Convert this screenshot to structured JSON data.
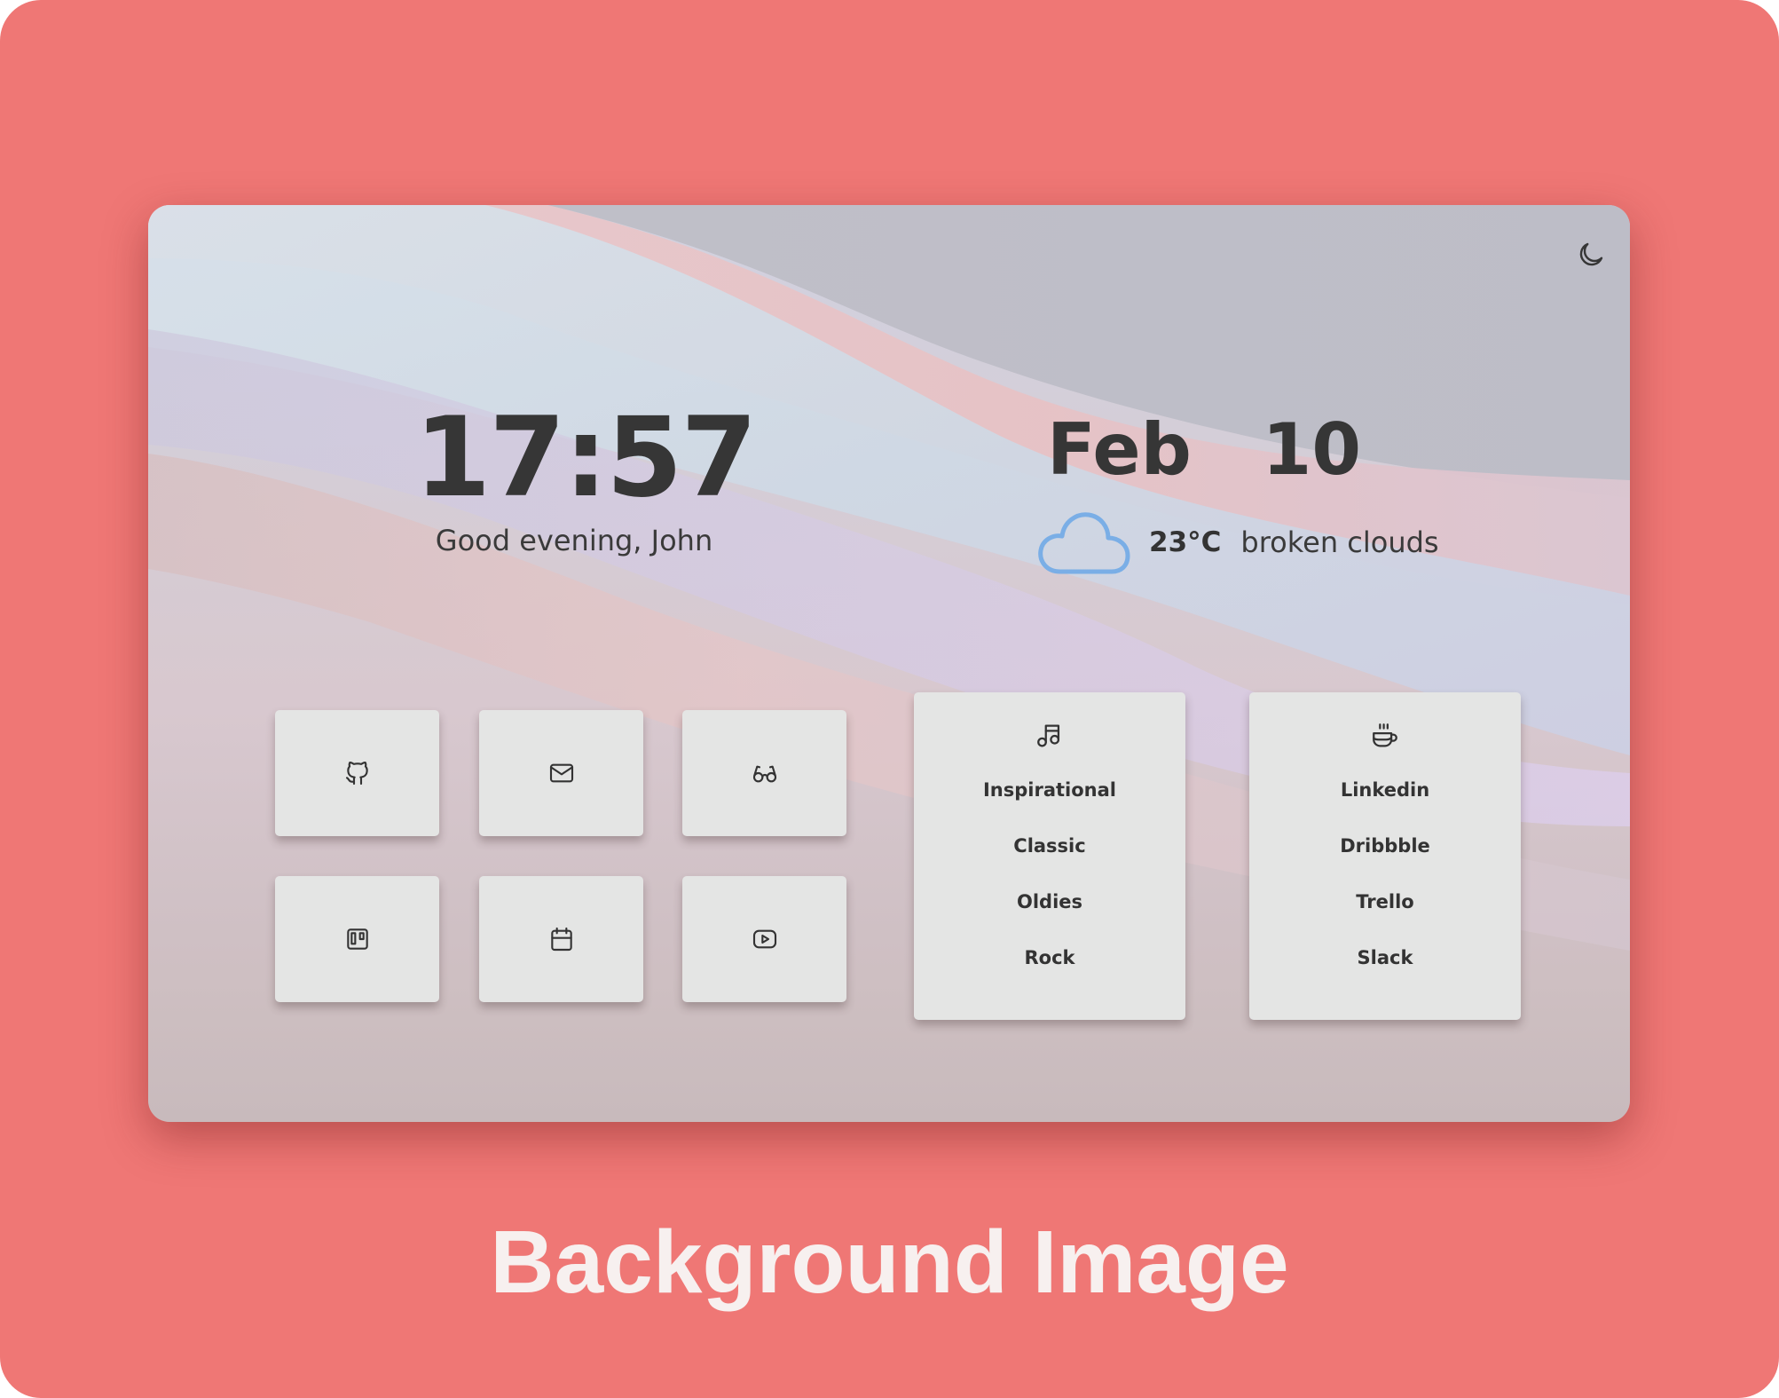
{
  "clock": {
    "time": "17:57",
    "greeting": "Good evening, John"
  },
  "date": {
    "text": "Feb  10"
  },
  "weather": {
    "temperature": "23°C",
    "condition": "broken clouds",
    "icon": "cloud-icon",
    "icon_color": "#7aaee6"
  },
  "theme_toggle": {
    "icon": "moon-icon"
  },
  "shortcuts": [
    {
      "icon": "github-icon"
    },
    {
      "icon": "mail-icon"
    },
    {
      "icon": "glasses-icon"
    },
    {
      "icon": "trello-icon"
    },
    {
      "icon": "calendar-icon"
    },
    {
      "icon": "youtube-icon"
    }
  ],
  "music_card": {
    "icon": "music-note-icon",
    "items": [
      "Inspirational",
      "Classic",
      "Oldies",
      "Rock"
    ]
  },
  "work_card": {
    "icon": "coffee-cup-icon",
    "items": [
      "Linkedin",
      "Dribbble",
      "Trello",
      "Slack"
    ]
  },
  "caption": "Background Image",
  "colors": {
    "outer_background": "#ef7775",
    "tile": "#e4e5e4",
    "text": "#363636",
    "caption": "#f7f0ef"
  }
}
